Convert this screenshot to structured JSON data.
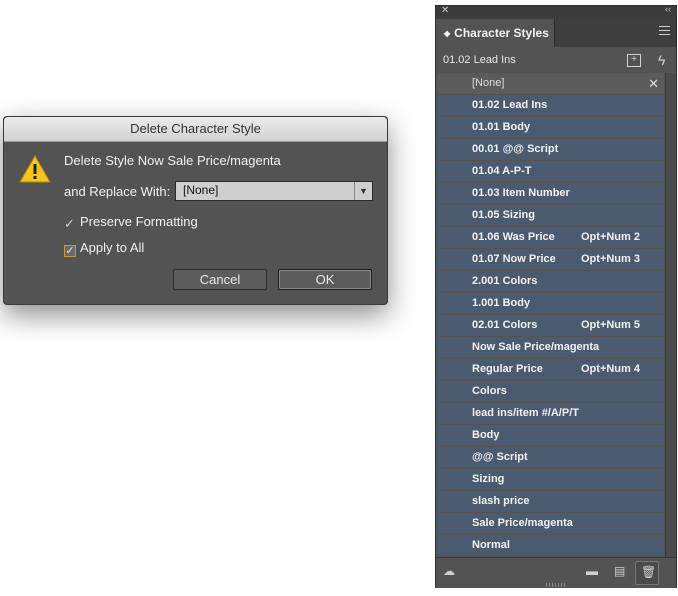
{
  "dialog": {
    "title": "Delete Character Style",
    "message": "Delete Style Now Sale Price/magenta",
    "replace_label": "and Replace With:",
    "replace_value": "[None]",
    "preserve_label": "Preserve Formatting",
    "apply_all_label": "Apply to All",
    "cancel_label": "Cancel",
    "ok_label": "OK",
    "warning_color": "#f5c518"
  },
  "panel": {
    "title": "Character Styles",
    "current_style": "01.02  Lead Ins",
    "rows": [
      {
        "label": "[None]",
        "shortcut": ""
      },
      {
        "label": "01.02  Lead Ins",
        "shortcut": ""
      },
      {
        "label": "01.01  Body",
        "shortcut": ""
      },
      {
        "label": "00.01  @@ Script",
        "shortcut": ""
      },
      {
        "label": "01.04  A-P-T",
        "shortcut": ""
      },
      {
        "label": "01.03  Item Number",
        "shortcut": ""
      },
      {
        "label": "01.05  Sizing",
        "shortcut": ""
      },
      {
        "label": "01.06  Was Price",
        "shortcut": "Opt+Num 2"
      },
      {
        "label": "01.07  Now Price",
        "shortcut": "Opt+Num 3"
      },
      {
        "label": "2.001  Colors",
        "shortcut": ""
      },
      {
        "label": "1.001  Body",
        "shortcut": ""
      },
      {
        "label": "02.01  Colors",
        "shortcut": "Opt+Num 5"
      },
      {
        "label": "Now Sale Price/magenta",
        "shortcut": ""
      },
      {
        "label": "Regular Price",
        "shortcut": "Opt+Num 4"
      },
      {
        "label": "Colors",
        "shortcut": ""
      },
      {
        "label": "lead ins/item #/A/P/T",
        "shortcut": ""
      },
      {
        "label": "Body",
        "shortcut": ""
      },
      {
        "label": "@@ Script",
        "shortcut": ""
      },
      {
        "label": "Sizing",
        "shortcut": ""
      },
      {
        "label": "slash price",
        "shortcut": ""
      },
      {
        "label": "Sale Price/magenta",
        "shortcut": ""
      },
      {
        "label": "Normal",
        "shortcut": ""
      }
    ],
    "row_color": "#4a5b70"
  }
}
